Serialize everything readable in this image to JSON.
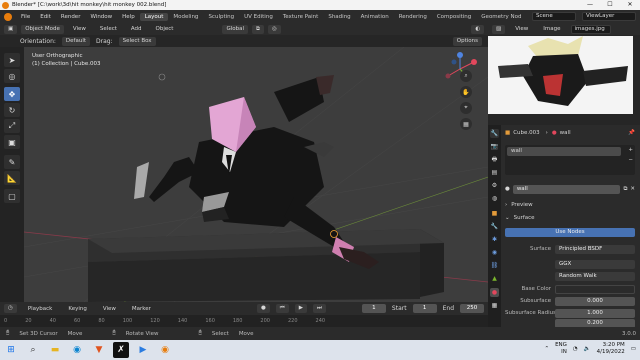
{
  "window": {
    "title": "Blender* [C:\\work\\3d\\hit monkey\\hit monkey 002.blend]",
    "min": "—",
    "max": "☐",
    "close": "✕"
  },
  "menu": [
    "File",
    "Edit",
    "Render",
    "Window",
    "Help"
  ],
  "workspaces": [
    "Layout",
    "Modeling",
    "Sculpting",
    "UV Editing",
    "Texture Paint",
    "Shading",
    "Animation",
    "Rendering",
    "Compositing",
    "Geometry Nod"
  ],
  "scene": "Scene",
  "view_layer": "ViewLayer",
  "viewport": {
    "mode": "Object Mode",
    "menus": [
      "View",
      "Select",
      "Add",
      "Object"
    ],
    "transform": "Global",
    "orientation_label": "Orientation:",
    "orientation_value": "Default",
    "drag_label": "Drag:",
    "drag_value": "Select Box",
    "options": "Options",
    "info_line1": "User Orthographic",
    "info_line2": "(1) Collection | Cube.003"
  },
  "timeline": {
    "menus": [
      "Playback",
      "Keying",
      "View",
      "Marker"
    ],
    "current_frame": "1",
    "start_label": "Start",
    "start": "1",
    "end_label": "End",
    "end": "250",
    "ticks": [
      "0",
      "20",
      "40",
      "60",
      "80",
      "100",
      "120",
      "140",
      "160",
      "180",
      "200",
      "220",
      "240"
    ]
  },
  "image_editor": {
    "menus": [
      "View",
      "Image"
    ],
    "image_name": "images.jpg"
  },
  "properties": {
    "object": "Cube.003",
    "material": "wall",
    "slot": "wall",
    "material_field": "wall",
    "preview": "Preview",
    "surface": "Surface",
    "use_nodes": "Use Nodes",
    "surface_label": "Surface",
    "surface_value": "Principled BSDF",
    "distribution": "GGX",
    "subsurface_method": "Random Walk",
    "base_color_label": "Base Color",
    "subsurface_label": "Subsurface",
    "subsurface_value": "0.000",
    "subsurface_radius_label": "Subsurface Radius",
    "radius_values": [
      "1.000",
      "0.200"
    ]
  },
  "status": {
    "items": [
      "Set 3D Cursor",
      "Move",
      "Rotate View",
      "Select",
      "Move"
    ],
    "version": "3.0.0"
  },
  "taskbar": {
    "lang": "ENG",
    "region": "IN",
    "time": "3:20 PM",
    "date": "4/19/2022"
  },
  "colors": {
    "accent": "#4772b3",
    "blender_orange": "#e87d0d",
    "active_tool": "#4772b3"
  }
}
